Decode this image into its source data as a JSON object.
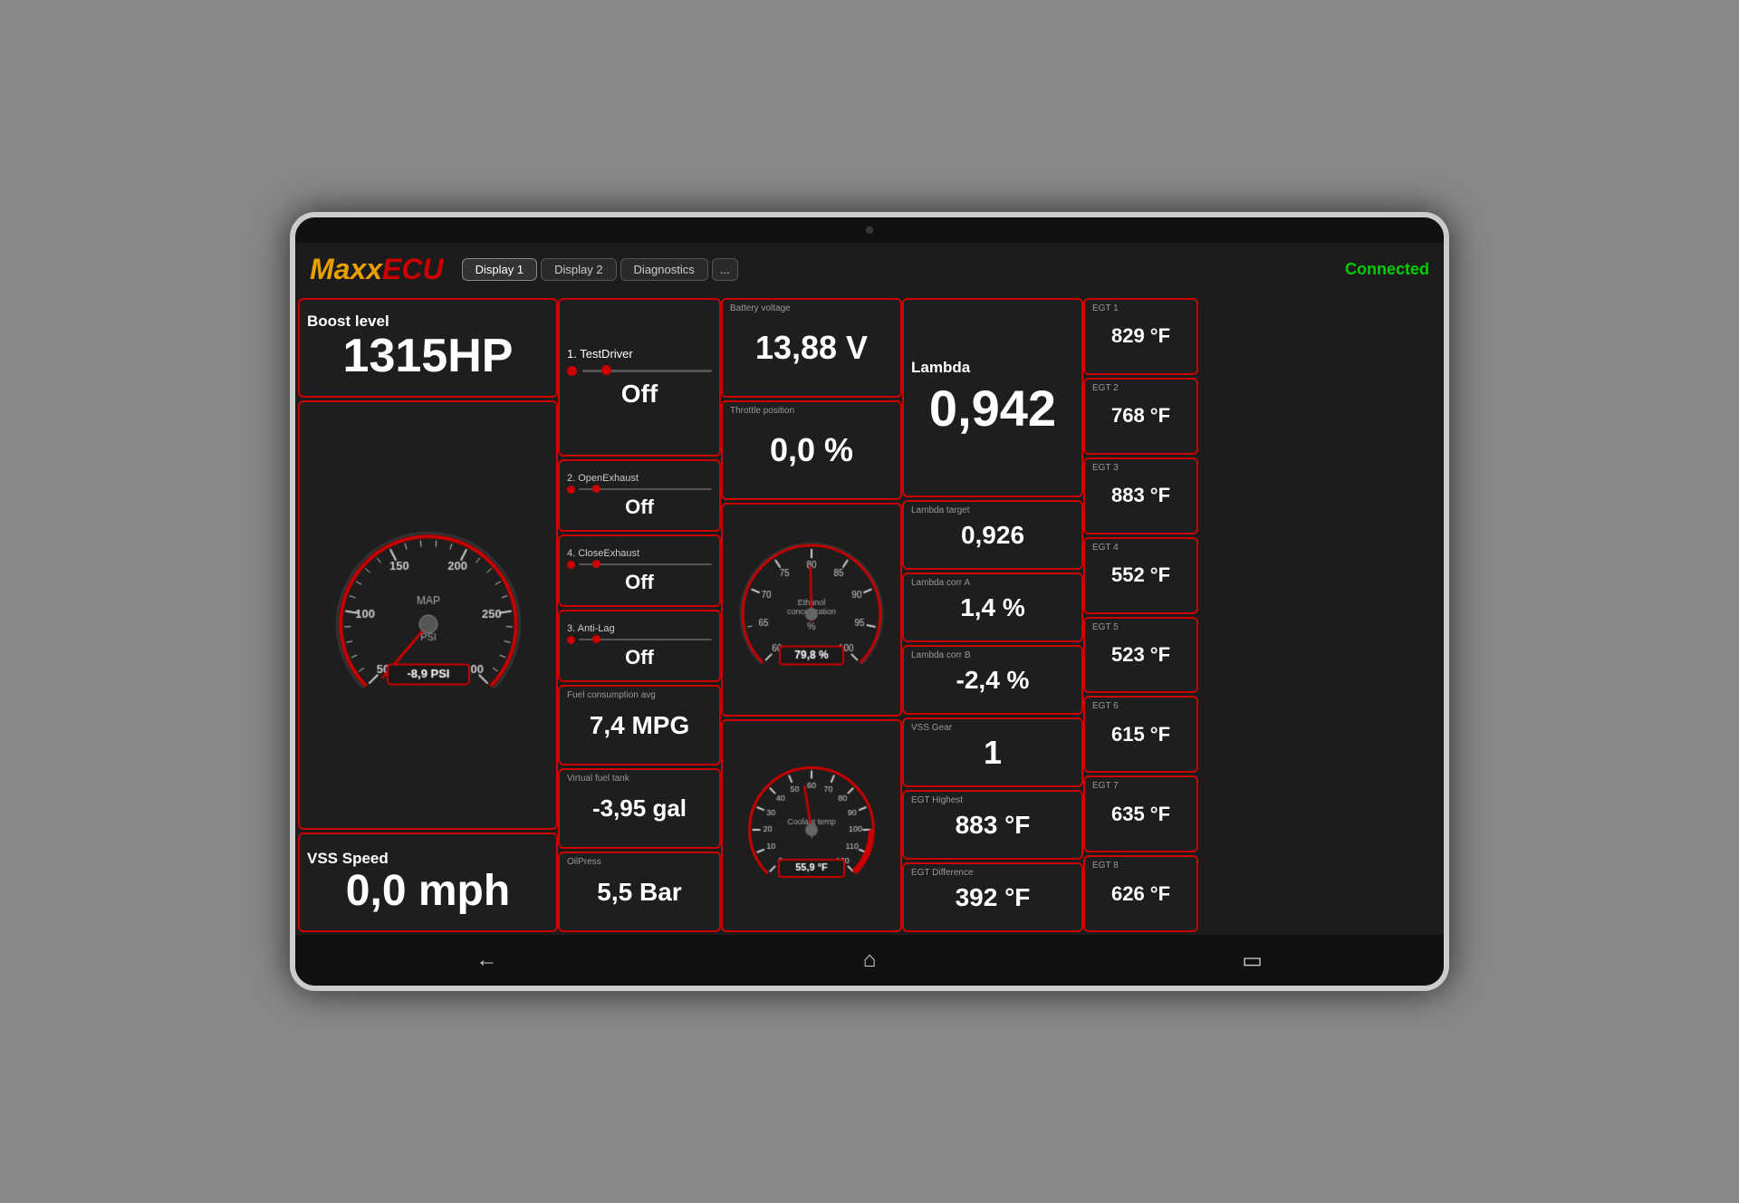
{
  "app": {
    "logo_maxx": "Maxx",
    "logo_ecu": "ECU",
    "connection_status": "Connected",
    "tabs": [
      {
        "label": "Display 1",
        "active": true
      },
      {
        "label": "Display 2",
        "active": false
      },
      {
        "label": "Diagnostics",
        "active": false
      },
      {
        "label": "...",
        "active": false
      }
    ]
  },
  "boost": {
    "label": "Boost level",
    "value": "1315HP"
  },
  "vss_speed": {
    "label": "VSS Speed",
    "value": "0,0 mph"
  },
  "map_gauge": {
    "label": "MAP",
    "unit": "PSI",
    "psi_value": "-8,9 PSI",
    "min": 50,
    "max": 300,
    "current": -8.9
  },
  "test_driver": {
    "label": "1. TestDriver",
    "state": "Off"
  },
  "open_exhaust": {
    "label": "2. OpenExhaust",
    "state": "Off"
  },
  "close_exhaust": {
    "label": "4. CloseExhaust",
    "state": "Off"
  },
  "anti_lag": {
    "label": "3. Anti-Lag",
    "state": "Off"
  },
  "fuel_consumption": {
    "label": "Fuel consumption avg",
    "value": "7,4 MPG"
  },
  "virtual_fuel_tank": {
    "label": "Virtual fuel tank",
    "value": "-3,95 gal"
  },
  "oil_press": {
    "label": "OilPress",
    "value": "5,5 Bar"
  },
  "battery_voltage": {
    "label": "Battery voltage",
    "value": "13,88 V"
  },
  "throttle": {
    "label": "Throttle position",
    "value": "0,0 %"
  },
  "ethanol": {
    "label": "Ethanol concentration",
    "unit": "%",
    "value": "79,8 %",
    "current": 79.8,
    "min": 60,
    "max": 100
  },
  "coolant": {
    "label": "Coolant temp",
    "unit": "°F",
    "value": "55,9 °F",
    "current": 55.9,
    "min": 0,
    "max": 120
  },
  "lambda": {
    "label": "Lambda",
    "value": "0,942"
  },
  "lambda_target": {
    "label": "Lambda target",
    "value": "0,926"
  },
  "lambda_corr_a": {
    "label": "Lambda corr A",
    "value": "1,4 %"
  },
  "lambda_corr_b": {
    "label": "Lambda corr B",
    "value": "-2,4 %"
  },
  "vss_gear": {
    "label": "VSS Gear",
    "value": "1"
  },
  "egt_highest": {
    "label": "EGT Highest",
    "value": "883 °F"
  },
  "egt_difference": {
    "label": "EGT Difference",
    "value": "392 °F"
  },
  "egt": [
    {
      "label": "EGT 1",
      "value": "829 °F"
    },
    {
      "label": "EGT 2",
      "value": "768 °F"
    },
    {
      "label": "EGT 3",
      "value": "883 °F"
    },
    {
      "label": "EGT 4",
      "value": "552 °F"
    },
    {
      "label": "EGT 5",
      "value": "523 °F"
    },
    {
      "label": "EGT 6",
      "value": "615 °F"
    },
    {
      "label": "EGT 7",
      "value": "635 °F"
    },
    {
      "label": "EGT 8",
      "value": "626 °F"
    }
  ],
  "nav": {
    "back": "←",
    "home": "⌂",
    "recent": "▭"
  }
}
